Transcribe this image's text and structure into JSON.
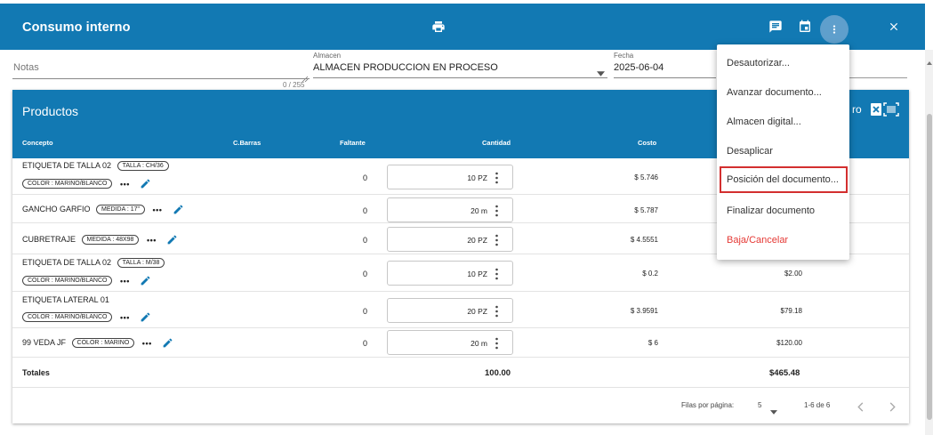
{
  "header": {
    "title": "Consumo interno",
    "icons": [
      "print-icon",
      "comment-icon",
      "calendar-icon",
      "more-vert-icon",
      "close-icon"
    ],
    "accent_color": "#1279b3"
  },
  "form": {
    "notas_placeholder": "Notas",
    "notas_counter": "0 / 255",
    "almacen_label": "Almacen",
    "almacen_value": "ALMACEN PRODUCCION EN PROCESO",
    "fecha_label": "Fecha",
    "fecha_value": "2025-06-04"
  },
  "products": {
    "title": "Productos",
    "partial_header_text": "ro",
    "columns": {
      "concepto": "Concepto",
      "barras": "C.Barras",
      "faltante": "Faltante",
      "cantidad": "Cantidad",
      "costo": "Costo"
    },
    "rows": [
      {
        "name": "ETIQUETA DE TALLA 02",
        "chip1": "TALLA : CH/36",
        "chip2": "COLOR : MARINO/BLANCO",
        "faltante": "0",
        "cantidad": "10 PZ",
        "costo": "$ 5.746",
        "total": ""
      },
      {
        "name": "GANCHO GARFIO",
        "chip1": "MEDIDA : 17\"",
        "chip2": "",
        "faltante": "0",
        "cantidad": "20 m",
        "costo": "$ 5.787",
        "total": ""
      },
      {
        "name": "CUBRETRAJE",
        "chip1": "MEDIDA : 48X98",
        "chip2": "",
        "faltante": "0",
        "cantidad": "20 PZ",
        "costo": "$ 4.5551",
        "total": ""
      },
      {
        "name": "ETIQUETA DE TALLA 02",
        "chip1": "TALLA : M/38",
        "chip2": "COLOR : MARINO/BLANCO",
        "faltante": "0",
        "cantidad": "10 PZ",
        "costo": "$ 0.2",
        "total": "$2.00"
      },
      {
        "name": "ETIQUETA LATERAL 01",
        "chip1": "",
        "chip2": "COLOR : MARINO/BLANCO",
        "faltante": "0",
        "cantidad": "20 PZ",
        "costo": "$ 3.9591",
        "total": "$79.18"
      },
      {
        "name": "99 VEDA JF",
        "chip1": "COLOR : MARINO",
        "chip2": "",
        "faltante": "0",
        "cantidad": "20 m",
        "costo": "$ 6",
        "total": "$120.00"
      }
    ],
    "totals": {
      "label": "Totales",
      "cantidad": "100.00",
      "total": "$465.48"
    },
    "pagination": {
      "rows_label": "Filas por página:",
      "rows_value": "5",
      "range": "1-6 de 6"
    }
  },
  "menu": {
    "items": [
      {
        "label": "Desautorizar..."
      },
      {
        "label": "Avanzar documento..."
      },
      {
        "label": "Almacen digital..."
      },
      {
        "label": "Desaplicar"
      },
      {
        "label": "Posición del documento..."
      },
      {
        "label": "Finalizar documento"
      },
      {
        "label": "Baja/Cancelar"
      }
    ],
    "highlight_color": "#d32f2f",
    "danger_color": "#e53935"
  }
}
